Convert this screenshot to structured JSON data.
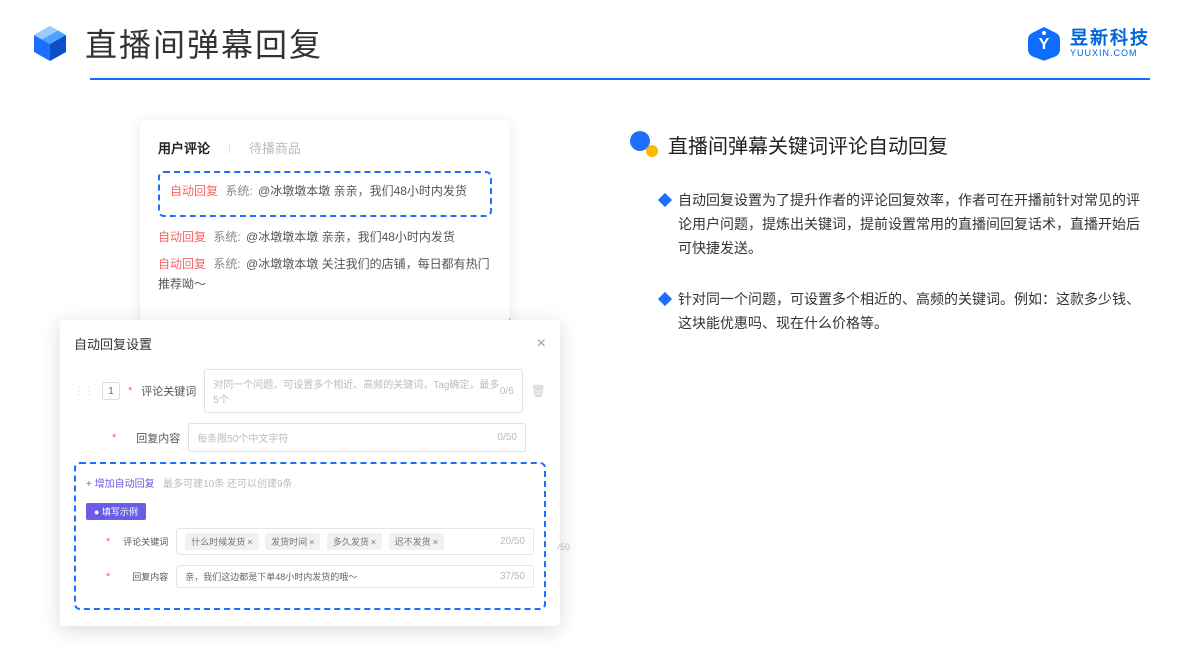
{
  "header": {
    "title": "直播间弹幕回复",
    "brand_name": "昱新科技",
    "brand_url": "YUUXIN.COM"
  },
  "comments": {
    "tab_active": "用户评论",
    "tab_inactive": "待播商品",
    "highlighted_tag": "自动回复",
    "highlighted_sys": "系统:",
    "highlighted_text": "@冰墩墩本墩 亲亲，我们48小时内发货",
    "line2_tag": "自动回复",
    "line2_sys": "系统:",
    "line2_text": "@冰墩墩本墩 亲亲，我们48小时内发货",
    "line3_tag": "自动回复",
    "line3_sys": "系统:",
    "line3_text": "@冰墩墩本墩 关注我们的店铺，每日都有热门推荐呦～"
  },
  "settings": {
    "title": "自动回复设置",
    "num": "1",
    "label_keyword": "评论关键词",
    "placeholder_keyword": "对同一个问题，可设置多个相近、高频的关键词，Tag确定，最多5个",
    "counter_keyword": "0/6",
    "label_content": "回复内容",
    "placeholder_content": "每条限50个中文字符",
    "counter_content": "0/50",
    "add_link": "+ 增加自动回复",
    "add_hint": "最多可建10条 还可以创建9条",
    "badge": "● 填写示例",
    "ex_label_keyword": "评论关键词",
    "ex_tags": [
      "什么时候发货",
      "发货时间",
      "多久发货",
      "迟不发货"
    ],
    "ex_counter_keyword": "20/50",
    "ex_label_content": "回复内容",
    "ex_content_value": "亲，我们这边都是下单48小时内发货的哦～",
    "ex_counter_content": "37/50",
    "outer_counter": "/50"
  },
  "right": {
    "section_title": "直播间弹幕关键词评论自动回复",
    "bullet1": "自动回复设置为了提升作者的评论回复效率，作者可在开播前针对常见的评论用户问题，提炼出关键词，提前设置常用的直播间回复话术，直播开始后可快捷发送。",
    "bullet2": "针对同一个问题，可设置多个相近的、高频的关键词。例如：这款多少钱、这块能优惠吗、现在什么价格等。"
  }
}
